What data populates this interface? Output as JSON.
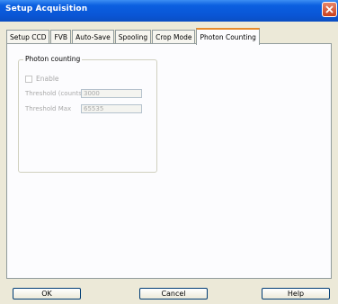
{
  "window": {
    "title": "Setup Acquisition"
  },
  "tabs": [
    {
      "label": "Setup CCD"
    },
    {
      "label": "FVB"
    },
    {
      "label": "Auto-Save"
    },
    {
      "label": "Spooling"
    },
    {
      "label": "Crop Mode"
    },
    {
      "label": "Photon Counting",
      "active": true
    }
  ],
  "photon_counting": {
    "group_label": "Photon counting",
    "enable_label": "Enable",
    "enable_checked": false,
    "threshold_counts_label": "Threshold (counts)",
    "threshold_counts_value": "3000",
    "threshold_max_label": "Threshold Max",
    "threshold_max_value": "65535"
  },
  "buttons": {
    "ok": "OK",
    "cancel": "Cancel",
    "help": "Help"
  },
  "colors": {
    "titlebar": "#0a56d6",
    "dialog_bg": "#ece9d8",
    "active_tab_highlight": "#e68b2c",
    "close_button": "#c9401f"
  }
}
